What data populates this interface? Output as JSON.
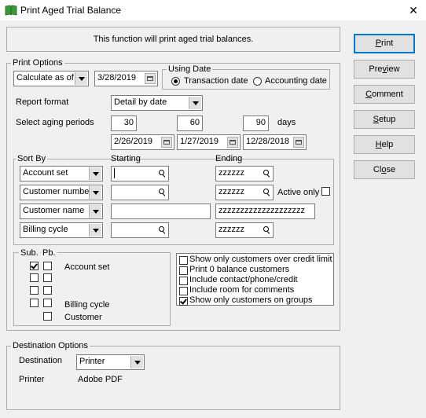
{
  "window": {
    "title": "Print Aged Trial Balance",
    "close": "✕"
  },
  "info": {
    "text": "This function will print aged trial balances."
  },
  "buttons": {
    "print": {
      "pre": "",
      "u": "P",
      "post": "rint"
    },
    "preview": {
      "pre": "Pre",
      "u": "v",
      "post": "iew"
    },
    "comment": {
      "pre": "",
      "u": "C",
      "post": "omment"
    },
    "setup": {
      "pre": "",
      "u": "S",
      "post": "etup"
    },
    "help": {
      "pre": "",
      "u": "H",
      "post": "elp"
    },
    "close": {
      "pre": "Cl",
      "u": "o",
      "post": "se"
    }
  },
  "print_options": {
    "title": "Print Options",
    "calc_as_of": "Calculate as of",
    "date": "3/28/2019",
    "using_date": {
      "title": "Using Date",
      "transaction": "Transaction date",
      "accounting": "Accounting date",
      "selected": "transaction"
    },
    "report_format_label": "Report format",
    "report_format": "Detail by date",
    "aging_label": "Select aging periods",
    "periods": [
      "30",
      "60",
      "90"
    ],
    "days": "days",
    "period_dates": [
      "2/26/2019",
      "1/27/2019",
      "12/28/2018"
    ]
  },
  "sort_by": {
    "title": "Sort By",
    "starting": "Starting",
    "ending": "Ending",
    "rows": [
      {
        "field": "Account set",
        "start": "",
        "end": "zzzzzz"
      },
      {
        "field": "Customer number",
        "start": "",
        "end": "zzzzzz"
      },
      {
        "field": "Customer name",
        "start": "",
        "end": "zzzzzzzzzzzzzzzzzzzz"
      },
      {
        "field": "Billing cycle",
        "start": "",
        "end": "zzzzzz"
      }
    ],
    "active_only": "Active only",
    "active_only_checked": false
  },
  "subtotals": {
    "sub": "Sub.",
    "pb": "Pb.",
    "rows": [
      {
        "label": "Account set",
        "sub": true,
        "pb": false
      },
      {
        "label": "",
        "sub": false,
        "pb": false
      },
      {
        "label": "",
        "sub": false,
        "pb": false
      },
      {
        "label": "Billing cycle",
        "sub": false,
        "pb": false
      },
      {
        "label": "Customer",
        "pb": false
      }
    ]
  },
  "options": [
    {
      "label": "Show only customers over credit limit",
      "checked": false
    },
    {
      "label": "Print 0 balance customers",
      "checked": false
    },
    {
      "label": "Include contact/phone/credit",
      "checked": false
    },
    {
      "label": "Include room for comments",
      "checked": false
    },
    {
      "label": "Show only customers on groups",
      "checked": true
    }
  ],
  "destination": {
    "title": "Destination Options",
    "dest_label": "Destination",
    "dest_value": "Printer",
    "printer_label": "Printer",
    "printer_value": "Adobe PDF"
  }
}
